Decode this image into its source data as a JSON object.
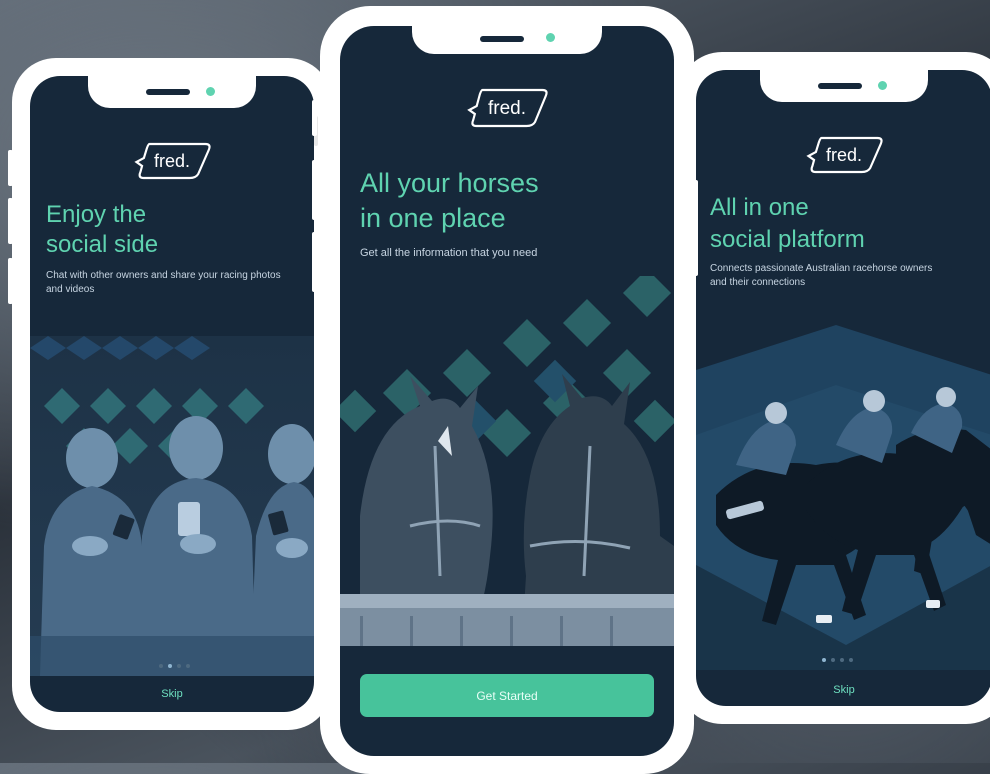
{
  "brand": {
    "logo_text": "fred.",
    "accent_color": "#5fd3b0",
    "screen_color": "#16283a",
    "button_color": "#47c39b"
  },
  "left_screen": {
    "headline_line1": "Enjoy the",
    "headline_line2": "social side",
    "subtitle": "Chat with other owners and share your racing photos and videos",
    "skip_label": "Skip",
    "page_indicator": {
      "count": 4,
      "active": 1
    }
  },
  "center_screen": {
    "headline_line1": "All your horses",
    "headline_line2": "in one place",
    "subtitle": "Get all the information that you need",
    "cta_label": "Get Started"
  },
  "right_screen": {
    "headline_line1": "All in one",
    "headline_line2": "social platform",
    "subtitle": "Connects passionate Australian racehorse owners and their connections",
    "skip_label": "Skip",
    "page_indicator": {
      "count": 4,
      "active": 0
    }
  }
}
